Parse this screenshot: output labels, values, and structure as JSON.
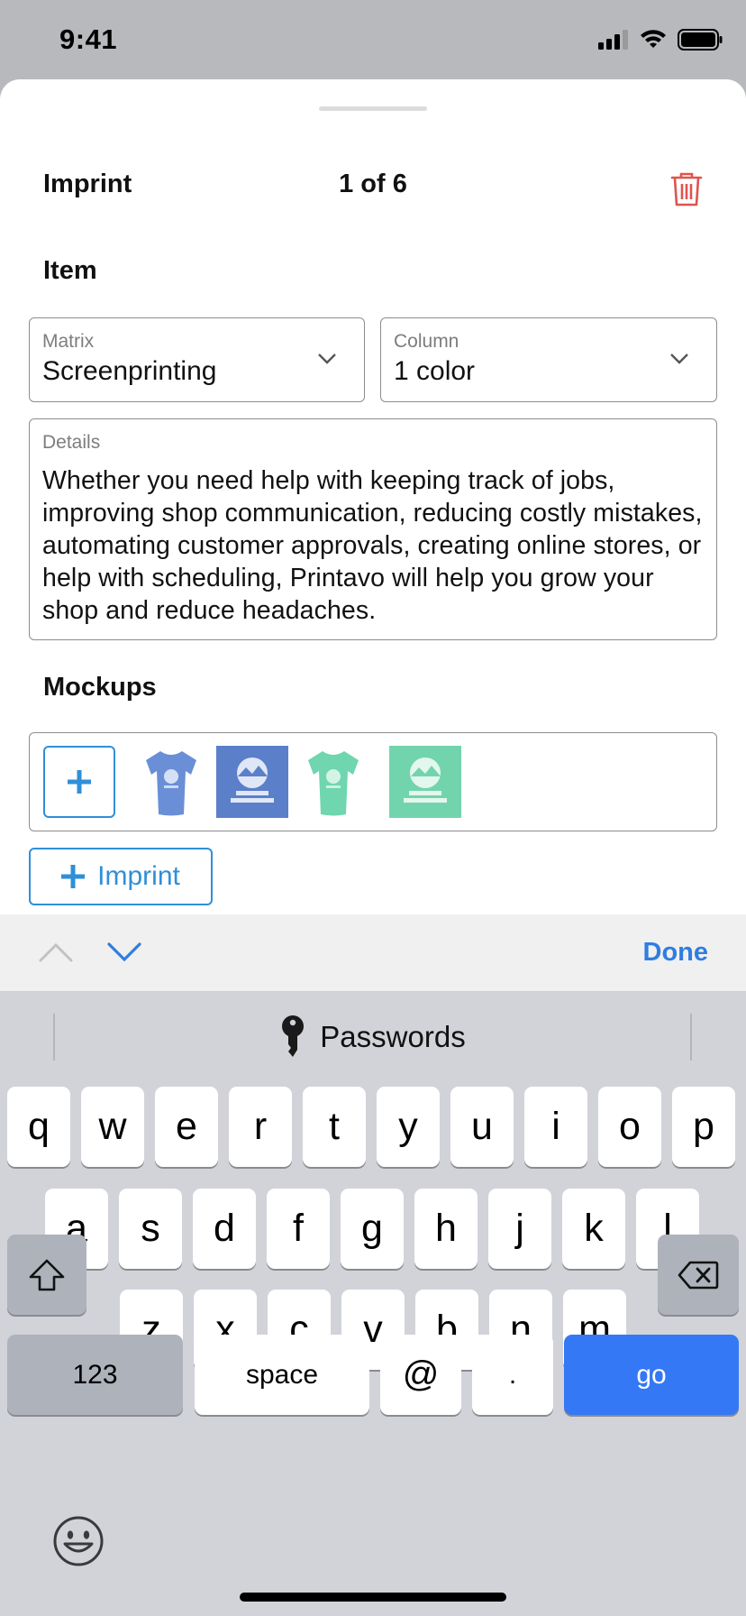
{
  "status_bar": {
    "time": "9:41"
  },
  "header": {
    "title": "Imprint",
    "counter": "1 of 6"
  },
  "item_section": {
    "title": "Item"
  },
  "matrix": {
    "label": "Matrix",
    "value": "Screenprinting"
  },
  "column": {
    "label": "Column",
    "value": "1 color"
  },
  "details": {
    "label": "Details",
    "value": "Whether you need help with keeping track of jobs, improving shop communication, reducing costly mistakes, automating customer approvals, creating online stores, or help with scheduling, Printavo will help you grow your shop and reduce headaches."
  },
  "mockups_section": {
    "title": "Mockups"
  },
  "mockups": [
    {
      "kind": "shirt",
      "color": "#6b8fd6"
    },
    {
      "kind": "print",
      "color": "#5b7fc9",
      "text_top": "BRAVE",
      "text_bottom": "WILDERNESS"
    },
    {
      "kind": "shirt",
      "color": "#6fd6b0"
    },
    {
      "kind": "print",
      "color": "#72d4ad",
      "text_top": "BRAVE",
      "text_bottom": "WILDERNESS"
    }
  ],
  "add_imprint_button": {
    "label": "Imprint"
  },
  "accessory_bar": {
    "done_label": "Done"
  },
  "keyboard": {
    "passwords_label": "Passwords",
    "row1": [
      "q",
      "w",
      "e",
      "r",
      "t",
      "y",
      "u",
      "i",
      "o",
      "p"
    ],
    "row2": [
      "a",
      "s",
      "d",
      "f",
      "g",
      "h",
      "j",
      "k",
      "l"
    ],
    "row3": [
      "z",
      "x",
      "c",
      "v",
      "b",
      "n",
      "m"
    ],
    "numbers_label": "123",
    "space_label": "space",
    "at_label": "@",
    "dot_label": ".",
    "go_label": "go"
  },
  "colors": {
    "accent": "#2f8fd8",
    "done": "#2f7de1",
    "delete": "#e0534f",
    "go_key": "#3478f6"
  }
}
